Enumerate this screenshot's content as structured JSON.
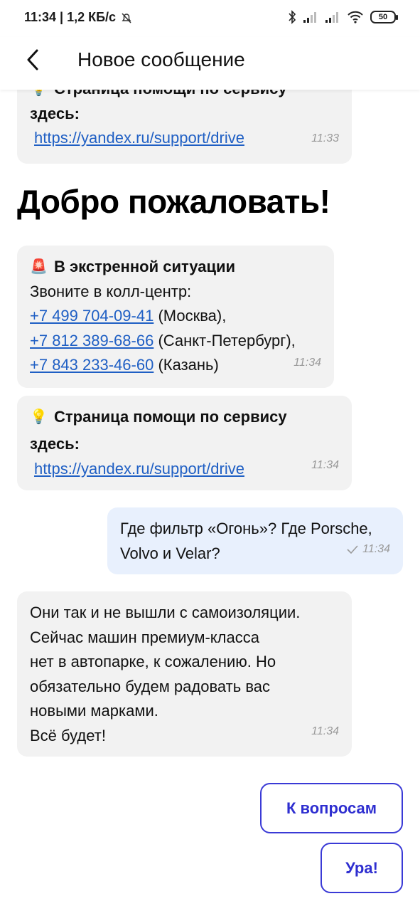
{
  "status_bar": {
    "time_speed": "11:34 | 1,2 КБ/с",
    "battery": "50"
  },
  "header": {
    "title": "Новое сообщение"
  },
  "messages": {
    "help_top": {
      "title": "Страница помощи по сервису",
      "here": "здесь:",
      "link": "https://yandex.ru/support/drive",
      "time": "11:33"
    },
    "welcome": "Добро пожаловать!",
    "emergency": {
      "title": "В экстренной ситуации",
      "intro": "Звоните в колл-центр:",
      "phones": [
        {
          "number": "+7 499 704-09-41",
          "city": "(Москва),"
        },
        {
          "number": "+7 812 389-68-66",
          "city": "(Санкт-Петербург),"
        },
        {
          "number": "+7 843 233-46-60",
          "city": "(Казань)"
        }
      ],
      "time": "11:34"
    },
    "help": {
      "title": "Страница помощи по сервису",
      "here": "здесь:",
      "link": "https://yandex.ru/support/drive",
      "time": "11:34"
    },
    "user_question": {
      "line1": "Где фильтр «Огонь»? Где Porsche,",
      "line2": "Volvo и Velar?",
      "time": "11:34"
    },
    "reply": {
      "lines": [
        "Они так и не вышли с самоизоляции.",
        "Сейчас машин премиум-класса",
        "нет в автопарке, к сожалению. Но",
        "обязательно будем радовать вас",
        "новыми марками.",
        "Всё будет!"
      ],
      "time": "11:34"
    }
  },
  "quick_replies": {
    "to_questions": "К вопросам",
    "hooray": "Ура!"
  },
  "colors": {
    "accent": "#2e2ed0",
    "link": "#1f5fc4",
    "incoming_bubble": "#f2f2f2",
    "outgoing_bubble": "#e8f0fd"
  }
}
